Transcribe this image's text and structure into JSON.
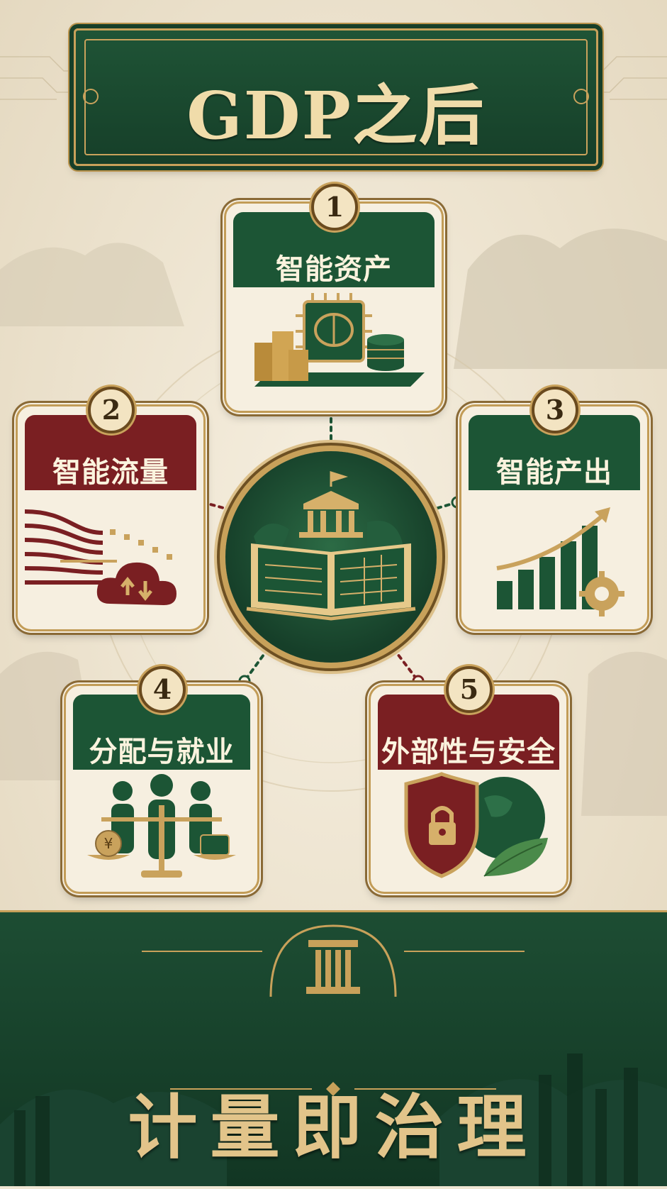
{
  "title": "GDP之后",
  "footer": {
    "text": "计量即治理"
  },
  "cards": [
    {
      "number": "1",
      "label": "智能资产",
      "icon": "brain-chip-assets-icon"
    },
    {
      "number": "2",
      "label": "智能流量",
      "icon": "data-flow-cloud-icon"
    },
    {
      "number": "3",
      "label": "智能产出",
      "icon": "bar-chart-gear-icon"
    },
    {
      "number": "4",
      "label": "分配与就业",
      "icon": "people-balance-scale-icon"
    },
    {
      "number": "5",
      "label": "外部性与安全",
      "icon": "shield-globe-leaf-icon"
    }
  ],
  "hub": {
    "icon": "ledger-book-government-icon"
  },
  "colors": {
    "green": "#1c5535",
    "red": "#7a1f22",
    "gold": "#c8a15a",
    "paper": "#f6efe0"
  }
}
